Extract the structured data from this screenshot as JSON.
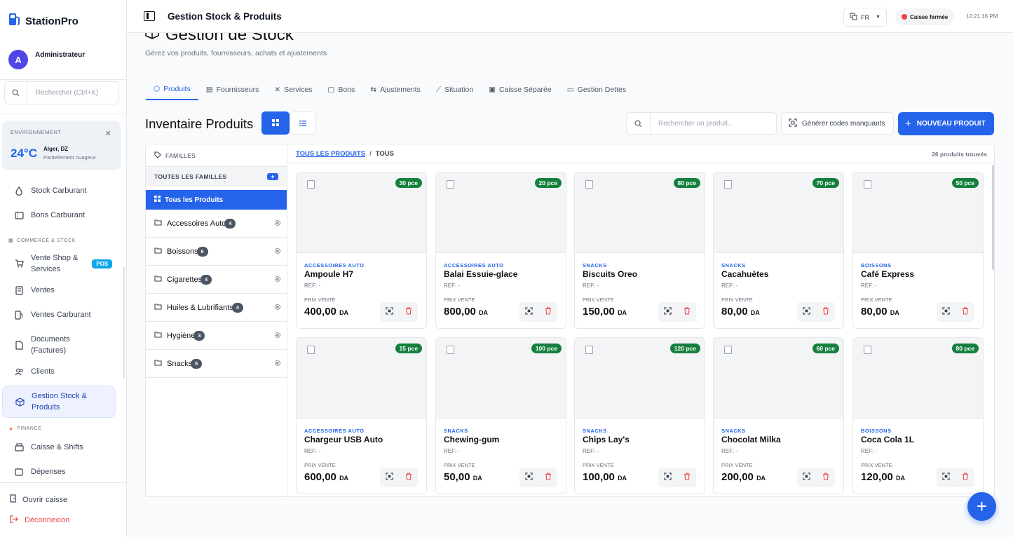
{
  "brand": {
    "name": "StationPro"
  },
  "user": {
    "initial": "A",
    "name": "Administrateur"
  },
  "sidebar_search": {
    "placeholder": "Rechercher (Ctrl+K)"
  },
  "weather": {
    "label": "ENVIRONNEMENT",
    "temp": "24°C",
    "city": "Alger, DZ",
    "condition": "Partiellement nuageux"
  },
  "nav": {
    "stock_carburant": "Stock Carburant",
    "bons_carburant": "Bons Carburant",
    "section_commerce": "COMMERCE & STOCK",
    "vente_shop_1": "Vente Shop &",
    "vente_shop_2": "Services",
    "pos_badge": "POS",
    "ventes": "Ventes",
    "ventes_carburant": "Ventes Carburant",
    "documents_1": "Documents",
    "documents_2": "(Factures)",
    "clients": "Clients",
    "gestion_stock_1": "Gestion Stock &",
    "gestion_stock_2": "Produits",
    "section_finance": "FINANCE",
    "caisse_shifts": "Caisse & Shifts",
    "depenses": "Dépenses"
  },
  "sidebar_bottom": {
    "ouvrir": "Ouvrir caisse",
    "deconnexion": "Déconnexion"
  },
  "header": {
    "title": "Gestion Stock & Produits",
    "lang": "FR",
    "caisse_status": "Caisse fermée",
    "time": "10:21:16 PM"
  },
  "page": {
    "title": "Gestion de Stock",
    "subtitle": "Gérez vos produits, fournisseurs, achats et ajustements"
  },
  "tabs": [
    "Produits",
    "Fournisseurs",
    "Services",
    "Bons",
    "Ajustements",
    "Situation",
    "Caisse Séparée",
    "Gestion Dettes"
  ],
  "inventory": {
    "title": "Inventaire Produits",
    "search_placeholder": "Rechercher un produit...",
    "generate_label": "Générer codes manquants",
    "new_label": "NOUVEAU PRODUIT"
  },
  "families": {
    "header": "FAMILLES",
    "all_label": "TOUTES LES FAMILLES",
    "selected": "Tous les Produits",
    "items": [
      {
        "name": "Accessoires Auto",
        "count": "4"
      },
      {
        "name": "Boissons",
        "count": "6"
      },
      {
        "name": "Cigarettes",
        "count": "4"
      },
      {
        "name": "Huiles & Lubrifiants",
        "count": "4"
      },
      {
        "name": "Hygiène",
        "count": "3"
      },
      {
        "name": "Snacks",
        "count": "5"
      }
    ]
  },
  "breadcrumb": {
    "link": "TOUS LES PRODUITS",
    "sep": "/",
    "current": "TOUS",
    "found": "26 produits trouvés"
  },
  "labels": {
    "ref": "REF: -",
    "prix": "PRIX VENTE",
    "currency": "DA"
  },
  "products": [
    {
      "stock": "30 pce",
      "category": "ACCESSOIRES AUTO",
      "name": "Ampoule H7",
      "price": "400,00"
    },
    {
      "stock": "20 pce",
      "category": "ACCESSOIRES AUTO",
      "name": "Balai Essuie-glace",
      "price": "800,00"
    },
    {
      "stock": "80 pce",
      "category": "SNACKS",
      "name": "Biscuits Oreo",
      "price": "150,00"
    },
    {
      "stock": "70 pce",
      "category": "SNACKS",
      "name": "Cacahuètes",
      "price": "80,00"
    },
    {
      "stock": "50 pce",
      "category": "BOISSONS",
      "name": "Café Express",
      "price": "80,00"
    },
    {
      "stock": "15 pce",
      "category": "ACCESSOIRES AUTO",
      "name": "Chargeur USB Auto",
      "price": "600,00"
    },
    {
      "stock": "100 pce",
      "category": "SNACKS",
      "name": "Chewing-gum",
      "price": "50,00"
    },
    {
      "stock": "120 pce",
      "category": "SNACKS",
      "name": "Chips Lay's",
      "price": "100,00"
    },
    {
      "stock": "60 pce",
      "category": "SNACKS",
      "name": "Chocolat Milka",
      "price": "200,00"
    },
    {
      "stock": "80 pce",
      "category": "BOISSONS",
      "name": "Coca Cola 1L",
      "price": "120,00"
    }
  ],
  "colors": {
    "primary": "#2563eb",
    "stock_badge": "#15803d",
    "danger": "#ef4444"
  }
}
